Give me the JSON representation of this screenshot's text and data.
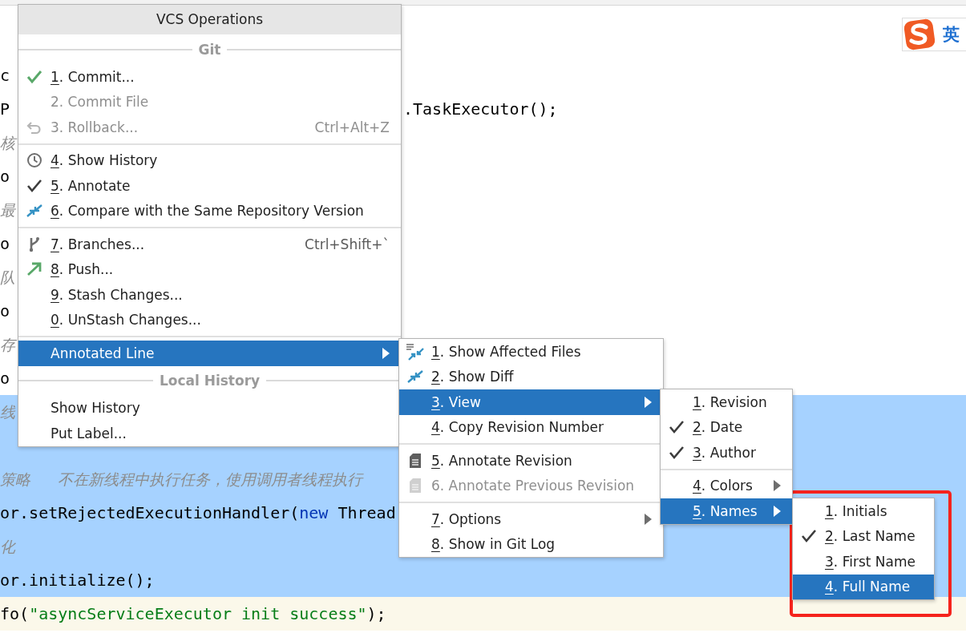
{
  "editor": {
    "lines": [
      {
        "segments": [
          {
            "text": "c",
            "kind": "plain"
          }
        ],
        "selected": false,
        "current": false
      },
      {
        "segments": [
          {
            "text": "P",
            "kind": "plain"
          }
        ],
        "tail": ".TaskExecutor();",
        "selected": false,
        "current": false
      },
      {
        "segments": [
          {
            "text": "核",
            "kind": "comment"
          }
        ],
        "selected": false,
        "current": false
      },
      {
        "segments": [
          {
            "text": "o",
            "kind": "plain"
          }
        ],
        "selected": false,
        "current": false
      },
      {
        "segments": [
          {
            "text": "最",
            "kind": "comment"
          }
        ],
        "selected": false,
        "current": false
      },
      {
        "segments": [
          {
            "text": "o",
            "kind": "plain"
          }
        ],
        "selected": false,
        "current": false
      },
      {
        "segments": [
          {
            "text": "队",
            "kind": "comment"
          }
        ],
        "selected": false,
        "current": false
      },
      {
        "segments": [
          {
            "text": "o",
            "kind": "plain"
          }
        ],
        "selected": false,
        "current": false
      },
      {
        "segments": [
          {
            "text": "存",
            "kind": "comment"
          }
        ],
        "selected": false,
        "current": false
      },
      {
        "segments": [
          {
            "text": "o",
            "kind": "plain"
          }
        ],
        "selected": false,
        "current": false
      },
      {
        "segments": [
          {
            "text": "线",
            "kind": "comment"
          }
        ],
        "selected": true,
        "current": false
      },
      {
        "selected": true,
        "current": false
      },
      {
        "segments": [
          {
            "text": "策略   不在新线程中执行任务，使用调用者线程执行",
            "kind": "comment"
          }
        ],
        "selected": true,
        "current": false
      },
      {
        "segments": [
          {
            "text": "or.setRejectedExecutionHandler(",
            "kind": "plain"
          },
          {
            "text": "new",
            "kind": "keyword"
          },
          {
            "text": " Thread",
            "kind": "plain"
          }
        ],
        "selected": true,
        "current": false
      },
      {
        "segments": [
          {
            "text": "化",
            "kind": "comment"
          }
        ],
        "selected": true,
        "current": false
      },
      {
        "segments": [
          {
            "text": "or.initialize();",
            "kind": "plain"
          }
        ],
        "selected": true,
        "current": false
      },
      {
        "segments": [
          {
            "text": "fo(",
            "kind": "plain"
          },
          {
            "text": "\"asyncServiceExecutor init success\"",
            "kind": "string"
          },
          {
            "text": ");",
            "kind": "plain"
          }
        ],
        "selected": false,
        "current": true
      }
    ]
  },
  "ime": {
    "text": "英"
  },
  "menus": [
    {
      "title": "VCS Operations",
      "items": [
        {
          "kind": "header",
          "label": "Git"
        },
        {
          "kind": "item",
          "mnemonic": "1",
          "label": ". Commit...",
          "selected": false,
          "disabled": false
        },
        {
          "kind": "item",
          "label": "2. Commit File",
          "selected": false,
          "disabled": true
        },
        {
          "kind": "item",
          "label": "3. Rollback...",
          "shortcut": "Ctrl+Alt+Z",
          "selected": false,
          "disabled": true
        },
        {
          "kind": "separator"
        },
        {
          "kind": "item",
          "mnemonic": "4",
          "label": ". Show History",
          "selected": false,
          "disabled": false
        },
        {
          "kind": "item",
          "mnemonic": "5",
          "label": ". Annotate",
          "selected": false,
          "disabled": false
        },
        {
          "kind": "item",
          "mnemonic": "6",
          "label": ". Compare with the Same Repository Version",
          "selected": false,
          "disabled": false
        },
        {
          "kind": "separator"
        },
        {
          "kind": "item",
          "mnemonic": "7",
          "label": ". Branches...",
          "shortcut": "Ctrl+Shift+`",
          "selected": false,
          "disabled": false
        },
        {
          "kind": "item",
          "mnemonic": "8",
          "label": ". Push...",
          "selected": false,
          "disabled": false
        },
        {
          "kind": "item",
          "mnemonic": "9",
          "label": ". Stash Changes...",
          "selected": false,
          "disabled": false
        },
        {
          "kind": "item",
          "mnemonic": "0",
          "label": ". UnStash Changes...",
          "selected": false,
          "disabled": false
        },
        {
          "kind": "separator"
        },
        {
          "kind": "item",
          "label": "Annotated Line",
          "submenu": true,
          "selected": true,
          "disabled": false
        },
        {
          "kind": "header",
          "label": "Local History"
        },
        {
          "kind": "item",
          "label": "Show History",
          "selected": false,
          "disabled": false
        },
        {
          "kind": "item",
          "label": "Put Label...",
          "selected": false,
          "disabled": false
        }
      ]
    },
    {
      "items": [
        {
          "kind": "item",
          "mnemonic": "1",
          "label": ". Show Affected Files",
          "selected": false,
          "disabled": false
        },
        {
          "kind": "item",
          "mnemonic": "2",
          "label": ". Show Diff",
          "selected": false,
          "disabled": false
        },
        {
          "kind": "item",
          "mnemonic": "3",
          "label": ". View",
          "submenu": true,
          "selected": true,
          "disabled": false
        },
        {
          "kind": "item",
          "mnemonic": "4",
          "label": ". Copy Revision Number",
          "selected": false,
          "disabled": false
        },
        {
          "kind": "separator"
        },
        {
          "kind": "item",
          "mnemonic": "5",
          "label": ". Annotate Revision",
          "selected": false,
          "disabled": false
        },
        {
          "kind": "item",
          "label": "6. Annotate Previous Revision",
          "selected": false,
          "disabled": true
        },
        {
          "kind": "separator"
        },
        {
          "kind": "item",
          "mnemonic": "7",
          "label": ". Options",
          "submenu": true,
          "selected": false,
          "disabled": false
        },
        {
          "kind": "item",
          "mnemonic": "8",
          "label": ". Show in Git Log",
          "selected": false,
          "disabled": false
        }
      ]
    },
    {
      "items": [
        {
          "kind": "item",
          "mnemonic": "1",
          "label": ". Revision",
          "checked": false,
          "selected": false
        },
        {
          "kind": "item",
          "mnemonic": "2",
          "label": ". Date",
          "checked": true,
          "selected": false
        },
        {
          "kind": "item",
          "mnemonic": "3",
          "label": ". Author",
          "checked": true,
          "selected": false
        },
        {
          "kind": "separator"
        },
        {
          "kind": "item",
          "mnemonic": "4",
          "label": ". Colors",
          "submenu": true,
          "checked": false,
          "selected": false
        },
        {
          "kind": "item",
          "mnemonic": "5",
          "label": ". Names",
          "submenu": true,
          "checked": false,
          "selected": true
        }
      ]
    },
    {
      "items": [
        {
          "kind": "item",
          "mnemonic": "1",
          "label": ". Initials",
          "checked": false,
          "selected": false
        },
        {
          "kind": "item",
          "mnemonic": "2",
          "label": ". Last Name",
          "checked": true,
          "selected": false
        },
        {
          "kind": "item",
          "mnemonic": "3",
          "label": ". First Name",
          "checked": false,
          "selected": false
        },
        {
          "kind": "item",
          "mnemonic": "4",
          "label": ". Full Name",
          "checked": false,
          "selected": true
        }
      ]
    }
  ]
}
